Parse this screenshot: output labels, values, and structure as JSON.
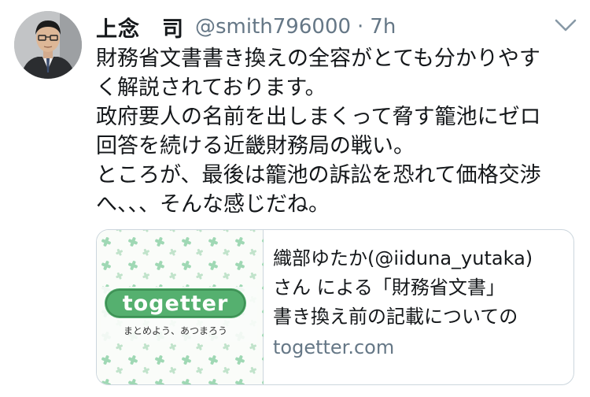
{
  "tweet": {
    "author_name": "上念　司",
    "handle": "@smith796000",
    "separator": "·",
    "time": "7h",
    "text": "財務省文書書き換えの全容がとても分かりやす\nく解説されております。\n政府要人の名前を出しまくって脅す籠池にゼロ\n回答を続ける近畿財務局の戦い。\nところが、最後は籠池の訴訟を恐れて価格交渉\nへ、、、そんな感じだね。"
  },
  "card": {
    "title": "織部ゆたか(@iiduna_yutaka)\nさん による「財務省文書」\n書き換え前の記載についての",
    "domain": "togetter.com",
    "logo_text": "togetter",
    "logo_tagline": "まとめよう、あつまろう"
  },
  "colors": {
    "secondary_text": "#657786",
    "border": "#ccd6dd",
    "logo_green": "#55b06f"
  },
  "icons": {
    "menu": "chevron-down-icon"
  }
}
